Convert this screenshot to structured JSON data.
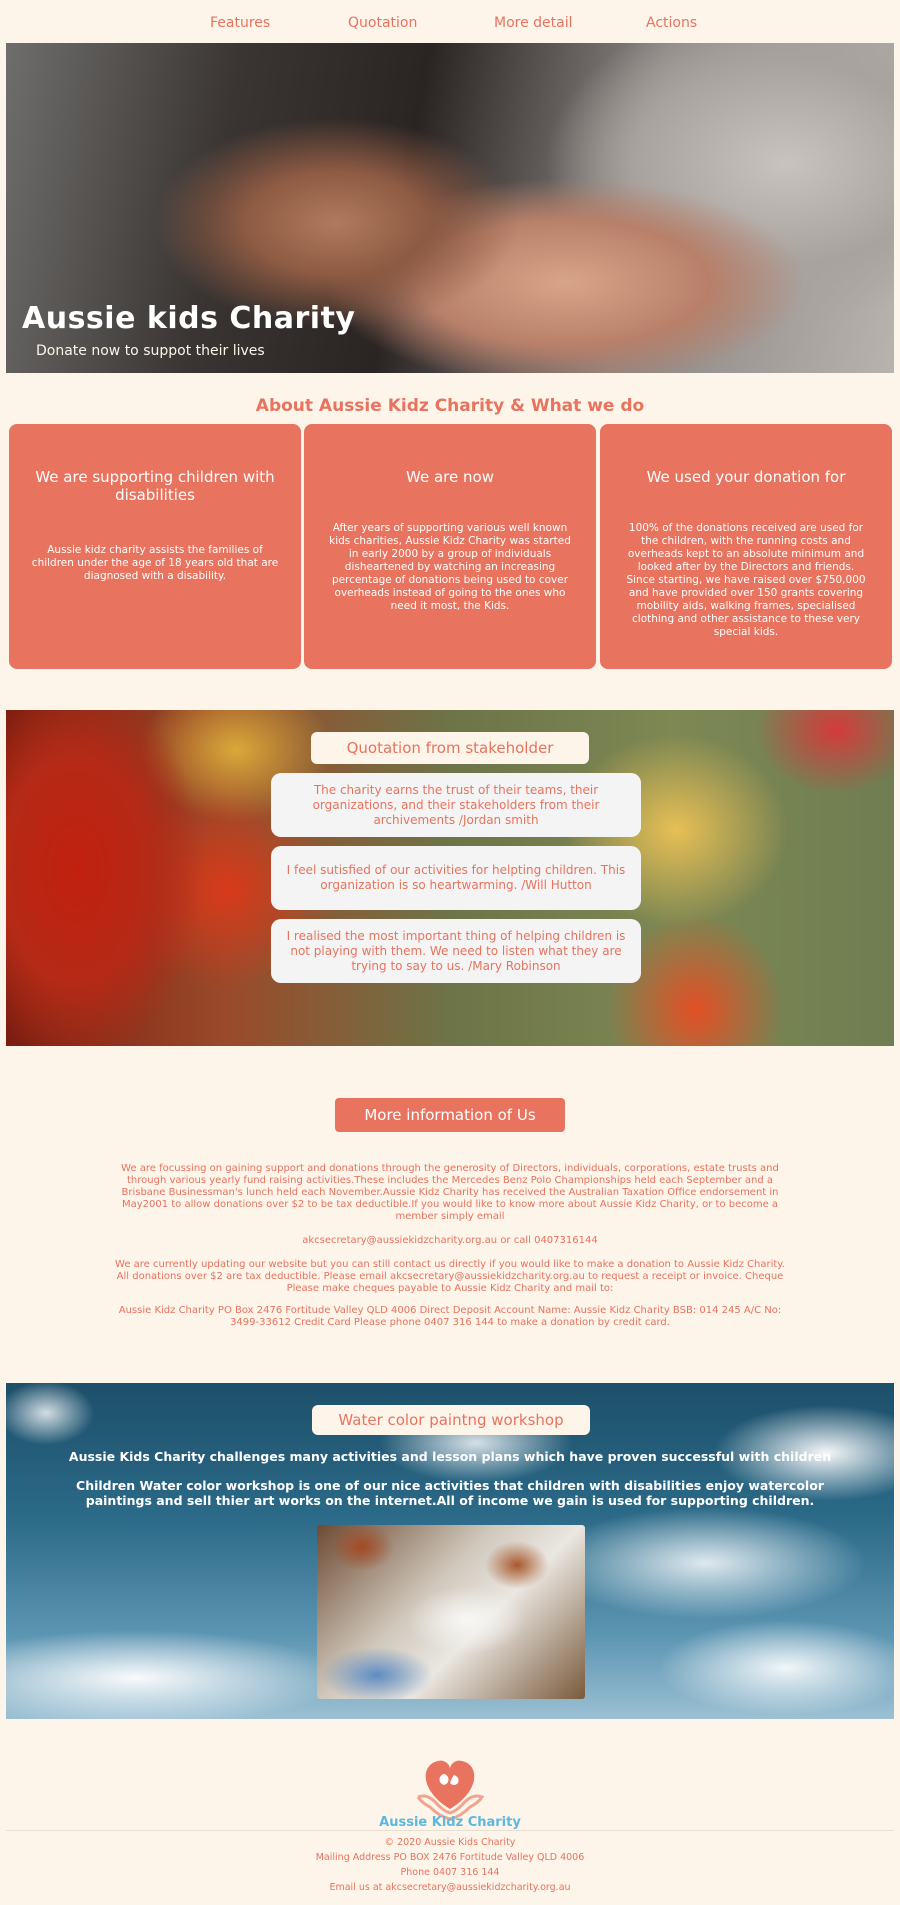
{
  "nav": {
    "items": [
      "Features",
      "Quotation",
      "More detail",
      "Actions"
    ]
  },
  "hero": {
    "title": "Aussie kids Charity",
    "subtitle": "Donate now to suppot their lives"
  },
  "about": {
    "title": "About Aussie Kidz Charity & What we do",
    "cards": [
      {
        "heading": "We are supporting children with disabilities",
        "body": "Aussie kidz charity assists the families of children under the age of 18 years old that are diagnosed with a disability."
      },
      {
        "heading": "We are now",
        "body": "After years of supporting various well known kids charities, Aussie Kidz Charity was started in early 2000 by a group of individuals disheartened by watching an increasing percentage of donations being used to cover overheads instead of going to the ones who need it most, the Kids."
      },
      {
        "heading": "We used your donation for",
        "body": "100% of the donations received are used for the children, with the running costs and overheads kept to an absolute minimum and looked after by the Directors and friends. Since starting, we have raised over $750,000 and have provided over 150 grants covering mobility aids, walking frames, specialised clothing and other assistance to these very special kids."
      }
    ]
  },
  "quotation": {
    "title": "Quotation from stakeholder",
    "quotes": [
      "The charity earns the trust of their teams, their organizations, and their stakeholders from their archivements /Jordan smith",
      "I feel sutisfied of our activities for helpting children. This organization is so heartwarming. /Will Hutton",
      "I realised the most important thing of helping children is not playing with them. We need to listen what they are trying to say to us. /Mary Robinson"
    ]
  },
  "more_info": {
    "button": "More information of Us",
    "paragraph1": "We are focussing on gaining support and donations through the generosity of Directors, individuals, corporations, estate trusts and through various yearly fund raising activities.These includes the Mercedes Benz Polo Championships held each September and a Brisbane Businessman's lunch held each November.Aussie Kidz Charity has received the Australian Taxation Office endorsement in May2001 to allow donations over $2 to be tax deductible.If you would like to know more about Aussie Kidz Charity, or to become a member simply email",
    "contact": "akcsecretary@aussiekidzcharity.org.au or call 0407316144",
    "paragraph2": "We are currently updating our website but you can still contact us directly if you would like to make a donation to Aussie Kidz Charity. All donations over $2 are tax deductible. Please email akcsecretary@aussiekidzcharity.org.au to request a receipt or invoice. Cheque Please make cheques payable to Aussie Kidz Charity and mail to:",
    "paragraph3": "Aussie Kidz Charity PO Box 2476 Fortitude Valley QLD 4006 Direct Deposit Account Name: Aussie Kidz Charity BSB: 014 245 A/C No: 3499-33612 Credit Card Please phone 0407 316 144 to make a donation by credit card."
  },
  "workshop": {
    "title": "Water color paintng workshop",
    "line1": "Aussie Kids Charity challenges many activities and lesson plans which have proven successful with children",
    "line2": "Children Water color workshop is one of our nice activities that children with disabilities enjoy watercolor paintings and sell thier art works on the internet.All of income we gain is used for supporting children."
  },
  "footer": {
    "logo_text": "Aussie Kidz Charity",
    "copyright": "© 2020 Aussie Kids Charity",
    "address": "Mailing Address PO BOX 2476 Fortitude Valley QLD 4006",
    "phone": "Phone 0407 316 144",
    "email": "Email us at akcsecretary@aussiekidzcharity.org.au"
  },
  "colors": {
    "accent": "#e8735e",
    "background": "#fdf4ea",
    "logo_blue": "#5bb8e0"
  }
}
